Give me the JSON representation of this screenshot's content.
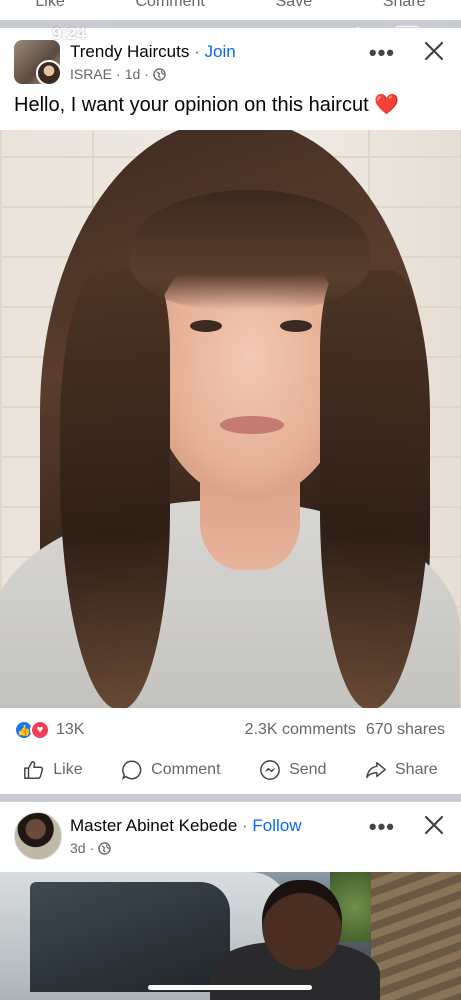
{
  "status_bar": {
    "time": "9:24"
  },
  "previous_post_actions": [
    "Like",
    "Comment",
    "Save",
    "Share"
  ],
  "post1": {
    "group_name": "Trendy Haircuts",
    "separator": "·",
    "join_label": "Join",
    "author": "ISRAE",
    "time_ago": "1d",
    "text": "Hello, I want your opinion on this haircut",
    "emoji": "❤️",
    "reactions_count": "13K",
    "comments": "2.3K comments",
    "shares": "670 shares",
    "actions": {
      "like": "Like",
      "comment": "Comment",
      "send": "Send",
      "share": "Share"
    }
  },
  "post2": {
    "author_name": "Master Abinet Kebede",
    "separator": "·",
    "follow_label": "Follow",
    "time_ago": "3d"
  },
  "colors": {
    "accent": "#0866ff",
    "like_blue": "#1877f2",
    "love_red": "#f33e58",
    "muted": "#65676b"
  }
}
